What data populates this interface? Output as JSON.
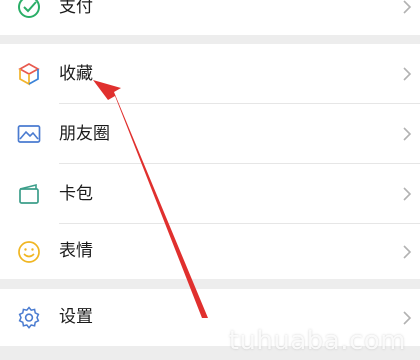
{
  "menu": {
    "pay_label": "支付",
    "favorites_label": "收藏",
    "moments_label": "朋友圈",
    "cards_label": "卡包",
    "stickers_label": "表情",
    "settings_label": "设置"
  },
  "colors": {
    "background": "#ededed",
    "row_background": "#ffffff",
    "arrow": "#e0302e",
    "pay_icon": "#2aae67",
    "moments_icon": "#4a7bd0",
    "cards_icon": "#3c9e8a",
    "stickers_icon": "#f0b622",
    "settings_icon": "#4a7bd0"
  },
  "icons": {
    "pay": "pay-check-icon",
    "favorites": "cube-icon",
    "moments": "picture-icon",
    "cards": "card-wallet-icon",
    "stickers": "smiley-icon",
    "settings": "gear-icon"
  },
  "watermark": "tuhuaba.com"
}
